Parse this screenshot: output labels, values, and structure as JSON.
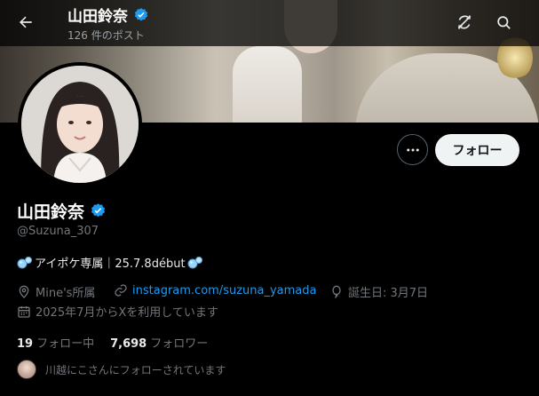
{
  "header": {
    "title": "山田鈴奈",
    "post_count": "126 件のポスト"
  },
  "profile": {
    "name": "山田鈴奈",
    "handle": "@Suzuna_307",
    "bio_text": "アイポケ専属｜25.7.8début",
    "bio_emoji": "bubbles",
    "location": "Mine's所属",
    "link": "instagram.com/suzuna_yamada",
    "birthday": "誕生日: 3月7日",
    "joined": "2025年7月からXを利用しています",
    "following_count": "19",
    "following_label": "フォロー中",
    "followers_count": "7,698",
    "followers_label": "フォロワー",
    "followed_by": "川越にこさんにフォローされています"
  },
  "actions": {
    "follow_label": "フォロー"
  },
  "icons": {
    "back": "arrow-left-icon",
    "sync": "sync-slash-icon",
    "search": "search-icon",
    "more": "more-horizontal-icon",
    "verified": "verified-badge-icon",
    "location": "location-pin-icon",
    "link": "link-icon",
    "birthday": "balloon-icon",
    "calendar": "calendar-icon"
  },
  "colors": {
    "accent": "#1d9bf0",
    "background": "#000000",
    "text_primary": "#e7e9ea",
    "text_secondary": "#71767b"
  }
}
